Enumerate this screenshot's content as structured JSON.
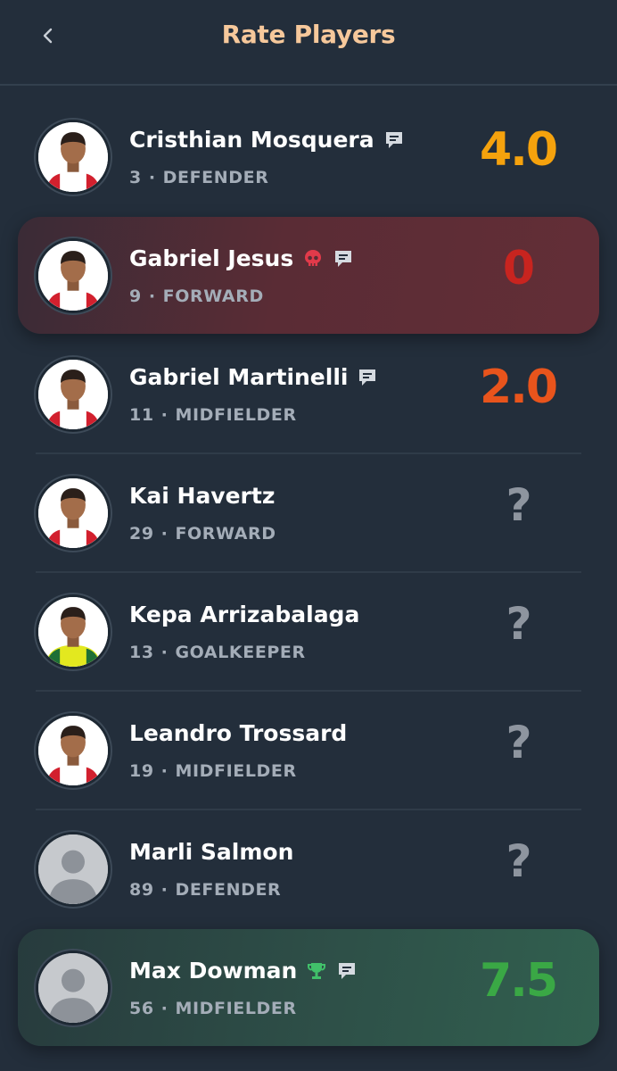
{
  "header": {
    "title": "Rate Players",
    "back_icon": "chevron-left-icon"
  },
  "players": [
    {
      "name": "Cristhian Mosquera",
      "number": "3",
      "position": "DEFENDER",
      "score": "4.0",
      "score_color": "#f5a20d",
      "highlight": "none",
      "icons": [
        "comment-icon"
      ],
      "avatar": "player-photo"
    },
    {
      "name": "Gabriel Jesus",
      "number": "9",
      "position": "FORWARD",
      "score": "0",
      "score_color": "#c8241f",
      "highlight": "red",
      "icons": [
        "skull-icon",
        "comment-icon"
      ],
      "avatar": "player-photo"
    },
    {
      "name": "Gabriel Martinelli",
      "number": "11",
      "position": "MIDFIELDER",
      "score": "2.0",
      "score_color": "#e8541c",
      "highlight": "none",
      "icons": [
        "comment-icon"
      ],
      "avatar": "player-photo"
    },
    {
      "name": "Kai Havertz",
      "number": "29",
      "position": "FORWARD",
      "score": "?",
      "score_color": "#8e959f",
      "highlight": "none",
      "icons": [],
      "avatar": "player-photo"
    },
    {
      "name": "Kepa Arrizabalaga",
      "number": "13",
      "position": "GOALKEEPER",
      "score": "?",
      "score_color": "#8e959f",
      "highlight": "none",
      "icons": [],
      "avatar": "player-photo-goalkeeper"
    },
    {
      "name": "Leandro Trossard",
      "number": "19",
      "position": "MIDFIELDER",
      "score": "?",
      "score_color": "#8e959f",
      "highlight": "none",
      "icons": [],
      "avatar": "player-photo"
    },
    {
      "name": "Marli Salmon",
      "number": "89",
      "position": "DEFENDER",
      "score": "?",
      "score_color": "#8e959f",
      "highlight": "none",
      "icons": [],
      "avatar": "placeholder-silhouette"
    },
    {
      "name": "Max Dowman",
      "number": "56",
      "position": "MIDFIELDER",
      "score": "7.5",
      "score_color": "#3aa845",
      "highlight": "green",
      "icons": [
        "trophy-icon",
        "comment-icon"
      ],
      "avatar": "placeholder-silhouette"
    }
  ],
  "colors": {
    "background": "#232e3b",
    "title": "#f6c89b",
    "meta_text": "#a4adb8",
    "skull": "#e23a4a",
    "trophy": "#41c06a"
  }
}
